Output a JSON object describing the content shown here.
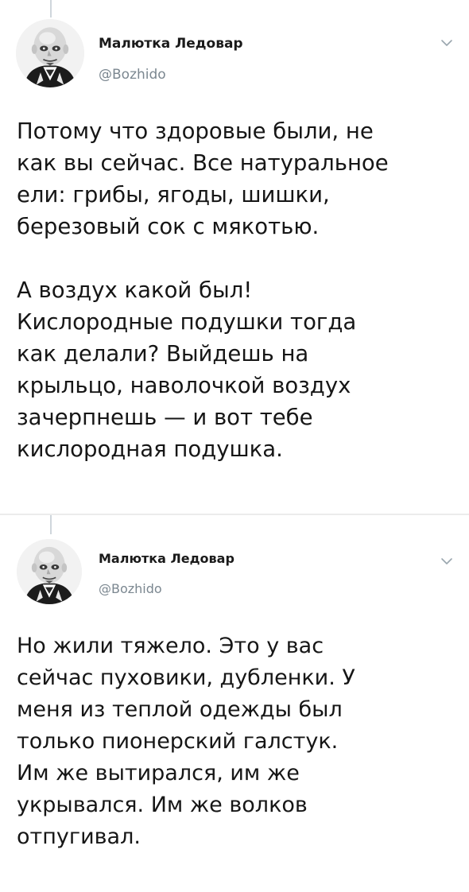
{
  "tweets": [
    {
      "author": {
        "name": "Малютка Ледовар",
        "handle": "@Bozhido",
        "avatar_icon": "bald-man-portrait-icon"
      },
      "menu_icon": "chevron-down-icon",
      "lines": [
        "Потому что здоровые были, не",
        "как вы сейчас. Все натуральное",
        "ели: грибы, ягоды, шишки,",
        "березовый сок с мякотью.",
        "",
        "А воздух какой был!",
        "Кислородные подушки тогда",
        "как делали? Выйдешь на",
        "крыльцо, наволочкой воздух",
        "зачерпнешь — и вот тебе",
        "кислородная подушка."
      ]
    },
    {
      "author": {
        "name": "Малютка Ледовар",
        "handle": "@Bozhido",
        "avatar_icon": "bald-man-portrait-icon"
      },
      "menu_icon": "chevron-down-icon",
      "lines": [
        "Но жили тяжело. Это у вас",
        "сейчас пуховики, дубленки. У",
        "меня из теплой одежды был",
        "только пионерский галстук.",
        "Им же вытирался, им же",
        "укрывался. Им же волков",
        "отпугивал."
      ]
    }
  ],
  "colors": {
    "text": "#161616",
    "handle": "#7b8790",
    "thread_line": "#cfd6dc",
    "background": "#ffffff"
  }
}
